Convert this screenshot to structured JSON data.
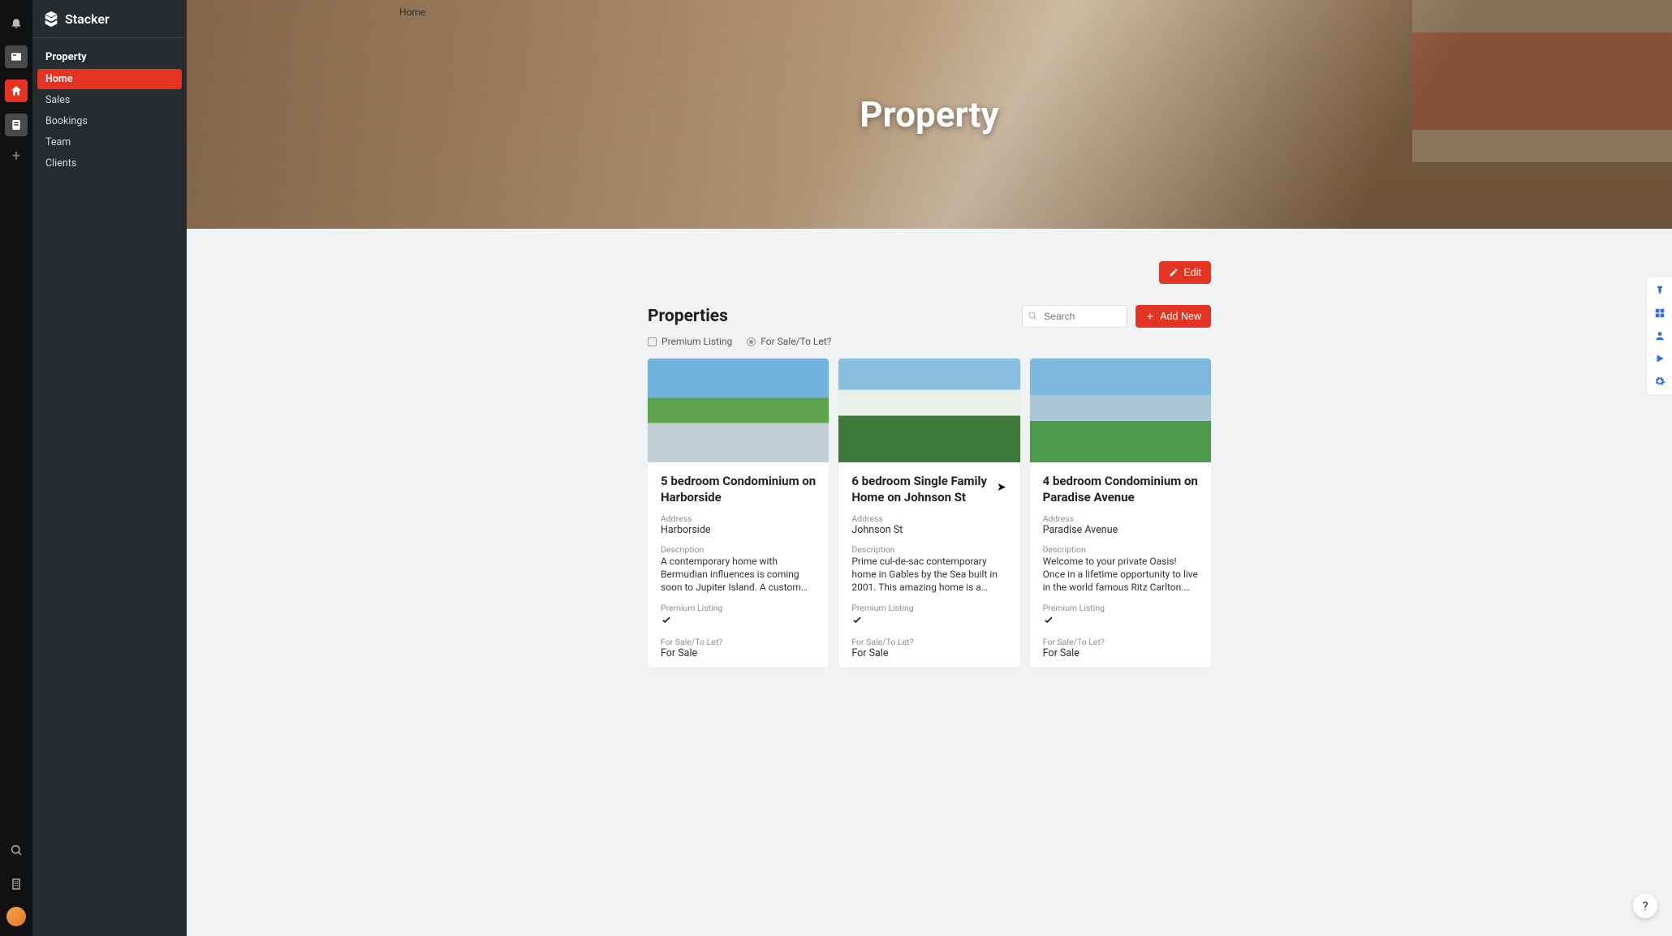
{
  "brand": {
    "name": "Stacker"
  },
  "sidebar": {
    "title": "Property",
    "items": [
      "Home",
      "Sales",
      "Bookings",
      "Team",
      "Clients"
    ],
    "activeIndex": 0
  },
  "hero": {
    "breadcrumb": "Home",
    "title": "Property"
  },
  "toolbar": {
    "edit": "Edit",
    "addNew": "Add New"
  },
  "list": {
    "title": "Properties",
    "searchPlaceholder": "Search",
    "filters": {
      "premium": "Premium Listing",
      "sale": "For Sale/To Let?"
    },
    "fieldLabels": {
      "address": "Address",
      "description": "Description",
      "premium": "Premium Listing",
      "sale": "For Sale/To Let?"
    }
  },
  "cards": [
    {
      "title": "5 bedroom Condominium on Harborside",
      "address": "Harborside",
      "description": "A contemporary home with Bermudian influences is coming soon to Jupiter Island. A custom home offering the highest qualit...",
      "premium": true,
      "sale": "For Sale"
    },
    {
      "title": "6 bedroom Single Family Home on Johnson St",
      "address": "Johnson St",
      "description": "Prime cul-de-sac contemporary home in Gables by the Sea built in 2001. This amazing home is a boaters dream and per...",
      "premium": true,
      "sale": "For Sale"
    },
    {
      "title": "4 bedroom Condominium on Paradise Avenue",
      "address": "Paradise Avenue",
      "description": "Welcome to your private Oasis! Once in a lifetime opportunity to live in the world famous Ritz Carlton. This unique residenc...",
      "premium": true,
      "sale": "For Sale"
    }
  ],
  "help": "?"
}
